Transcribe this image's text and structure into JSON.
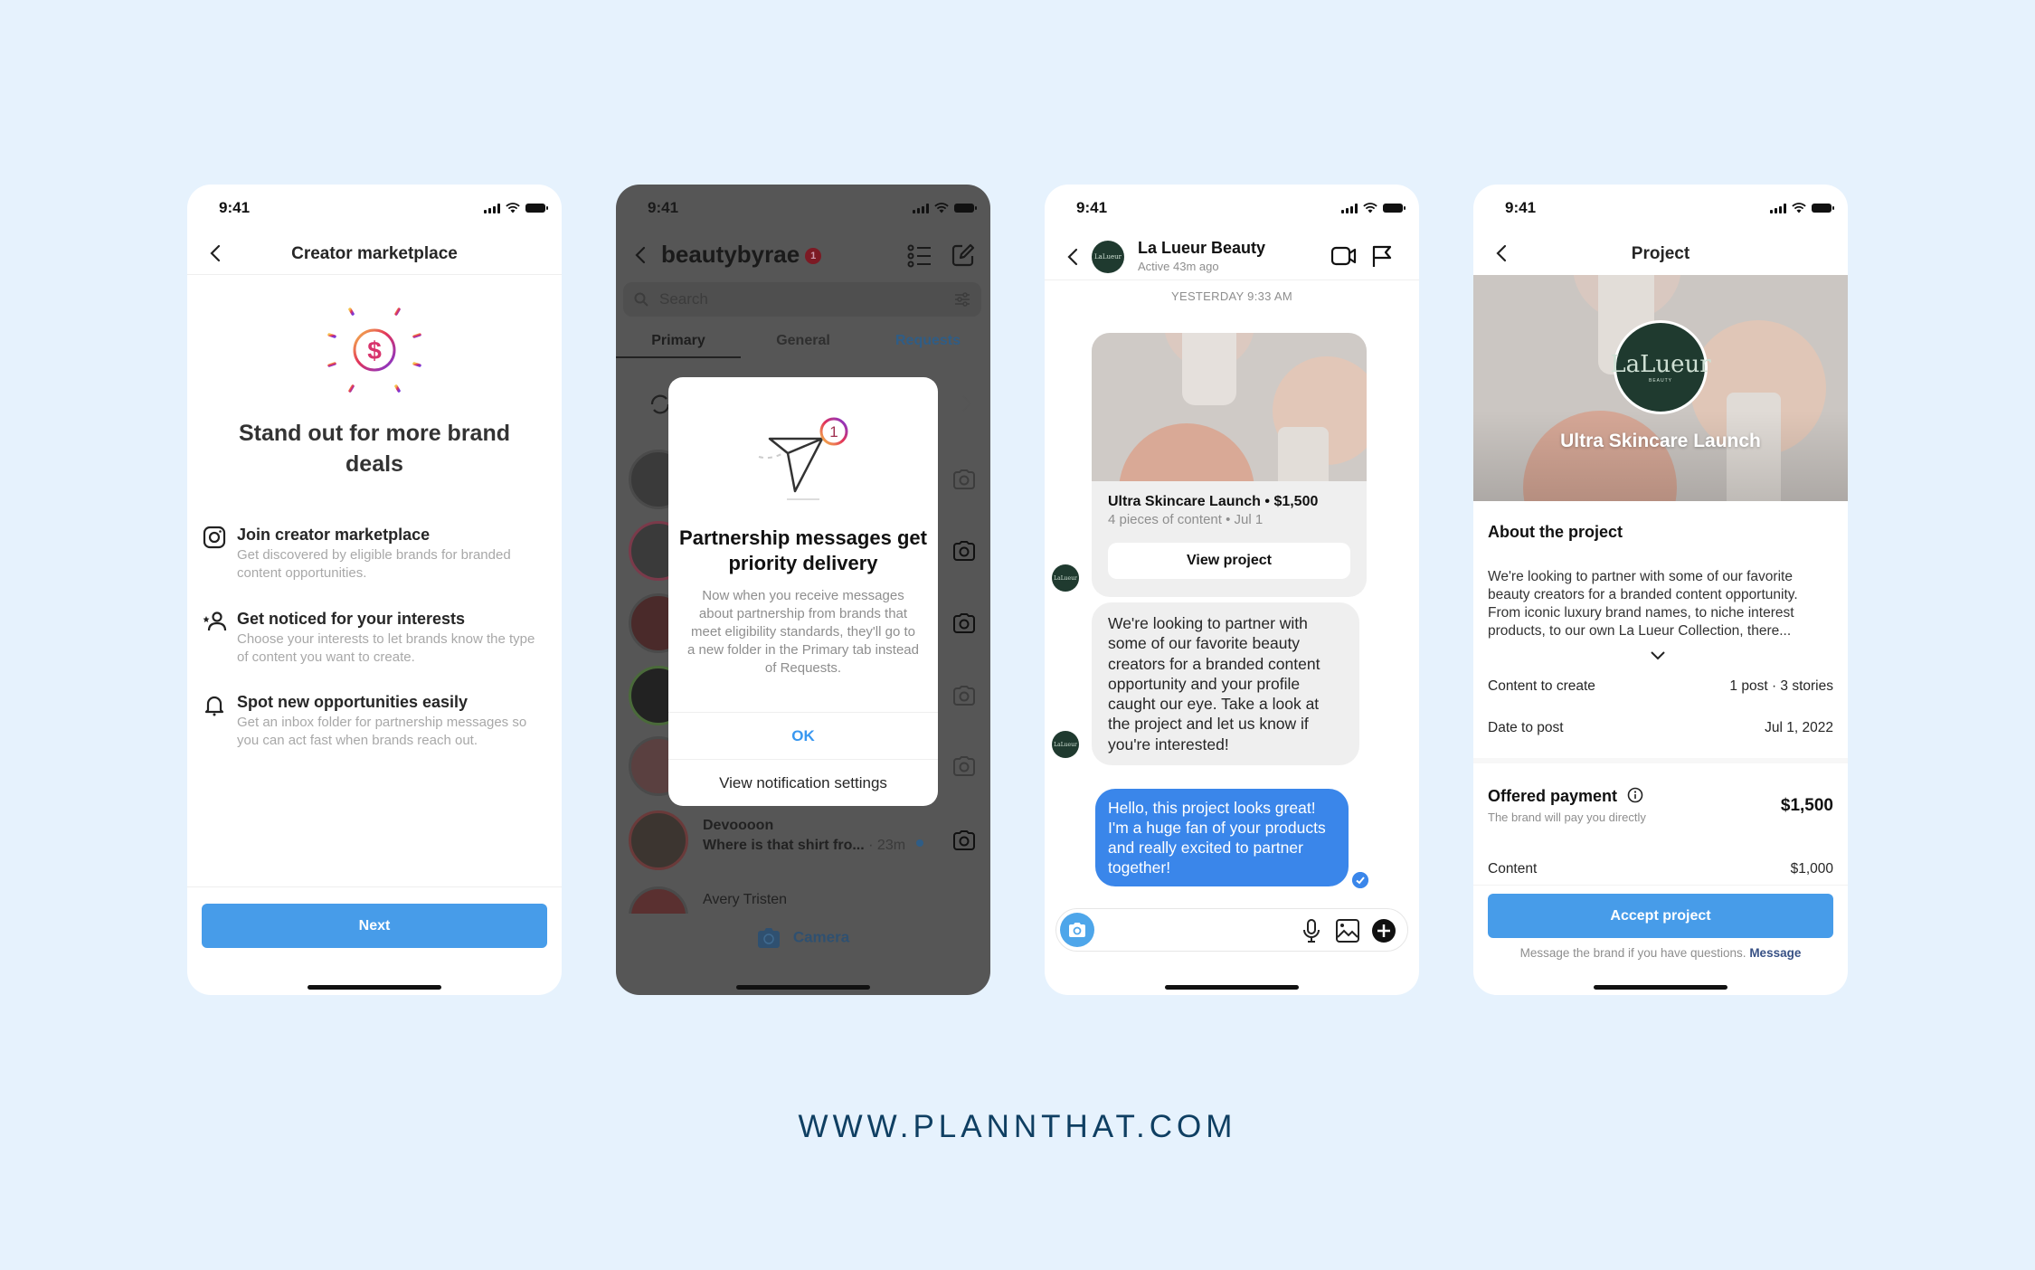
{
  "status_time": "9:41",
  "phone1": {
    "nav_title": "Creator marketplace",
    "heading": "Stand out for more brand deals",
    "hero_icon": "dollar-sun-icon",
    "features": [
      {
        "icon": "instagram-icon",
        "title": "Join creator marketplace",
        "desc": "Get discovered by eligible brands for branded content opportunities."
      },
      {
        "icon": "person-star-icon",
        "title": "Get noticed for your interests",
        "desc": "Choose your interests to let brands know the type of content you want to create."
      },
      {
        "icon": "bell-icon",
        "title": "Spot new opportunities easily",
        "desc": "Get an inbox folder for partnership messages so you can act fast when brands reach out."
      }
    ],
    "next_label": "Next",
    "accent": "#479ce9"
  },
  "phone2": {
    "username": "beautybyrae",
    "badge_count": "1",
    "search_placeholder": "Search",
    "tabs": [
      {
        "label": "Primary",
        "active": true
      },
      {
        "label": "General",
        "active": false
      },
      {
        "label": "Requests",
        "active": false
      }
    ],
    "visible_thread": {
      "name": "Devoooon",
      "message": "Where is that shirt fro...",
      "time": "· 23m",
      "unread": true
    },
    "partial_thread": {
      "name": "Avery Tristen"
    },
    "camera_label": "Camera",
    "modal": {
      "badge": "1",
      "title": "Partnership messages get priority delivery",
      "body": "Now when you receive messages about partnership from brands that meet eligibility standards, they'll go to a new folder in the Primary tab instead of Requests.",
      "ok_label": "OK",
      "settings_label": "View notification settings"
    }
  },
  "phone3": {
    "contact_name": "La Lueur Beauty",
    "contact_status": "Active 43m ago",
    "avatar_text": "LaLueur",
    "date_divider": "YESTERDAY 9:33 AM",
    "project_card": {
      "title": "Ultra Skincare Launch • $1,500",
      "subtitle": "4 pieces of content • Jul 1",
      "button_label": "View project"
    },
    "incoming_message": "We're looking to partner with some of our favorite beauty creators for a branded content opportunity and your profile caught our eye. Take a look at the project and let us know if you're interested!",
    "outgoing_message": "Hello, this project looks great! I'm a huge fan of your products and really excited to partner together!",
    "compose_value": "",
    "bubble_color": "#3a86ea"
  },
  "phone4": {
    "nav_title": "Project",
    "logo_text": "LaLueur",
    "logo_sub": "BEAUTY",
    "banner_title": "Ultra Skincare Launch",
    "about_heading": "About the project",
    "about_text": "We're looking to partner with some of our favorite beauty creators for a branded content opportunity. From iconic luxury brand names, to niche interest products, to our own La Lueur Collection, there...",
    "details": [
      {
        "label": "Content to create",
        "value": "1 post · 3 stories"
      },
      {
        "label": "Date to post",
        "value": "Jul 1, 2022"
      }
    ],
    "payment_heading": "Offered payment",
    "payment_sub": "The brand will pay you directly",
    "payment_total": "$1,500",
    "payment_lines": [
      {
        "label": "Content",
        "value": "$1,000"
      }
    ],
    "accept_label": "Accept project",
    "note_text": "Message the brand if you have questions.",
    "note_link": "Message"
  },
  "footer": {
    "url": "WWW.PLANNTHAT.COM"
  }
}
